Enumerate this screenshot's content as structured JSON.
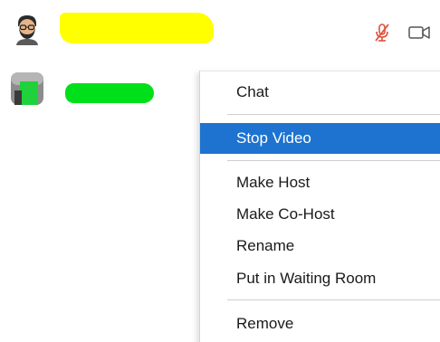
{
  "colors": {
    "accent": "#1d73cf",
    "redaction_self": "#ffff00",
    "redaction_other": "#00e01a",
    "muted_mic": "#e0503a"
  },
  "participants": [
    {
      "avatar_icon": "memoji-avatar-icon",
      "name_redacted": true,
      "mic_icon": "mic-muted-icon",
      "video_icon": "video-camera-icon"
    },
    {
      "avatar_icon": "photo-avatar-icon",
      "name_redacted": true
    }
  ],
  "context_menu": {
    "items": [
      {
        "label": "Chat"
      },
      {
        "label": "Stop Video",
        "selected": true
      },
      {
        "label": "Make Host"
      },
      {
        "label": "Make Co-Host"
      },
      {
        "label": "Rename"
      },
      {
        "label": "Put in Waiting Room"
      },
      {
        "label": "Remove"
      }
    ]
  }
}
